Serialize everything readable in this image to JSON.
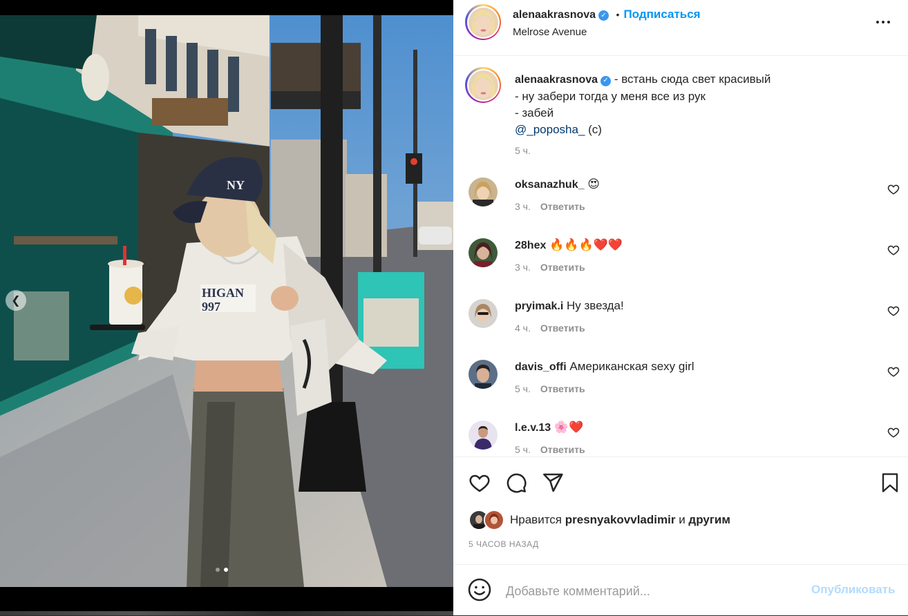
{
  "post": {
    "username": "alenaakrasnova",
    "verified_icon": "verified-badge-icon",
    "separator": "•",
    "follow_label": "Подписаться",
    "location": "Melrose Avenue",
    "caption": {
      "line1": "- встань сюда свет красивый",
      "line2": "- ну забери тогда у меня все из рук",
      "line3": "- забей",
      "mention": "@_poposha_",
      "suffix": " (c)",
      "time": "5 ч."
    },
    "carousel": {
      "current": 2,
      "total": 2
    }
  },
  "comments": [
    {
      "user": "oksanazhuk_",
      "text": "😍",
      "time": "3 ч.",
      "reply": "Ответить"
    },
    {
      "user": "28hex",
      "text": "🔥🔥🔥❤️❤️",
      "time": "3 ч.",
      "reply": "Ответить"
    },
    {
      "user": "pryimak.i",
      "text": "Ну звезда!",
      "time": "4 ч.",
      "reply": "Ответить"
    },
    {
      "user": "davis_offi",
      "text": "Американская sexy girl",
      "time": "5 ч.",
      "reply": "Ответить"
    },
    {
      "user": "l.e.v.13",
      "text": "🌸❤️",
      "time": "5 ч.",
      "reply": "Ответить"
    }
  ],
  "likes": {
    "prefix": "Нравится",
    "user": "presnyakovvladimir",
    "middle": "и",
    "others": "другим"
  },
  "posted_ago": "5 ЧАСОВ НАЗАД",
  "add_comment": {
    "placeholder": "Добавьте комментарий...",
    "publish_label": "Опубликовать"
  },
  "colors": {
    "accent": "#0095f6",
    "publish_disabled": "#b3dbff",
    "muted": "#8e8e8e",
    "mention": "#00376b"
  }
}
